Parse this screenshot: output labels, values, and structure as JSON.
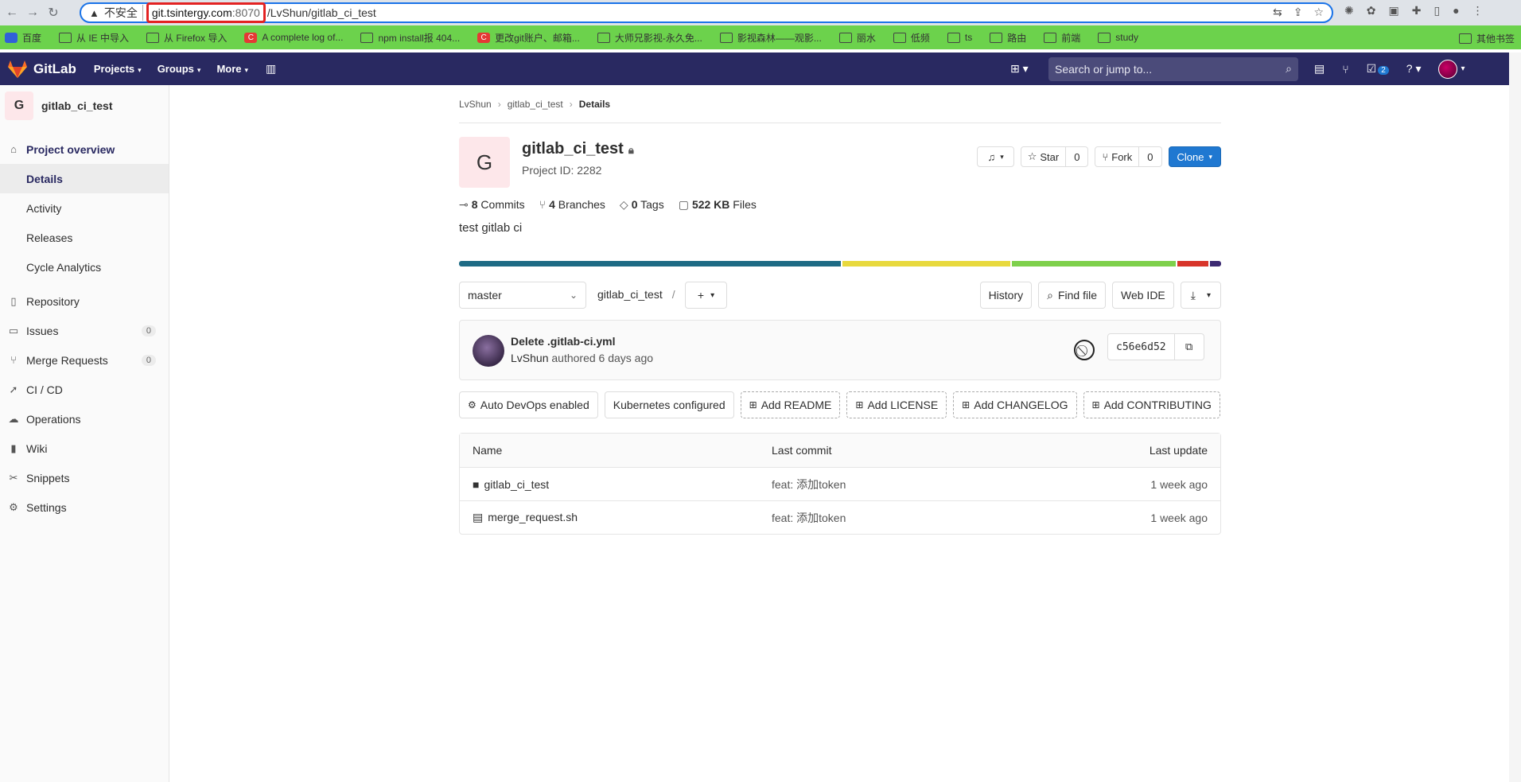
{
  "browser": {
    "insecure_label": "不安全",
    "url_host": "git.tsintergy.com",
    "url_port": ":8070",
    "url_path": "/LvShun/gitlab_ci_test",
    "bookmarks": [
      "百度",
      "从 IE 中导入",
      "从 Firefox 导入",
      "A complete log of...",
      "npm install报 404...",
      "更改git账户、邮箱...",
      "大师兄影视-永久免...",
      "影视森林——观影...",
      "丽水",
      "低频",
      "ts",
      "路由",
      "前端",
      "study"
    ],
    "bookmarks_other": "其他书签"
  },
  "header": {
    "brand": "GitLab",
    "nav": [
      "Projects",
      "Groups",
      "More"
    ],
    "search_placeholder": "Search or jump to...",
    "todo_count": "2"
  },
  "sidebar": {
    "project_initial": "G",
    "project_name": "gitlab_ci_test",
    "overview": "Project overview",
    "sub": [
      "Details",
      "Activity",
      "Releases",
      "Cycle Analytics"
    ],
    "items": [
      {
        "label": "Repository",
        "icon": "book-icon"
      },
      {
        "label": "Issues",
        "icon": "issues-icon",
        "count": "0"
      },
      {
        "label": "Merge Requests",
        "icon": "merge-icon",
        "count": "0"
      },
      {
        "label": "CI / CD",
        "icon": "rocket-icon"
      },
      {
        "label": "Operations",
        "icon": "cloud-icon"
      },
      {
        "label": "Wiki",
        "icon": "wiki-icon"
      },
      {
        "label": "Snippets",
        "icon": "scissors-icon"
      },
      {
        "label": "Settings",
        "icon": "gear-icon"
      }
    ]
  },
  "breadcrumb": [
    "LvShun",
    "gitlab_ci_test",
    "Details"
  ],
  "project": {
    "initial": "G",
    "title": "gitlab_ci_test",
    "id": "Project ID: 2282",
    "star_label": "Star",
    "star_count": "0",
    "fork_label": "Fork",
    "fork_count": "0",
    "clone_label": "Clone",
    "stats": {
      "commits_num": "8",
      "commits_label": "Commits",
      "branches_num": "4",
      "branches_label": "Branches",
      "tags_num": "0",
      "tags_label": "Tags",
      "files_num": "522 KB",
      "files_label": "Files"
    },
    "description": "test gitlab ci"
  },
  "lang_bar": [
    {
      "color": "#1e6b85",
      "share": 50
    },
    {
      "color": "#e8d93e",
      "share": 22
    },
    {
      "color": "#7ed04b",
      "share": 21.5
    },
    {
      "color": "#d8352a",
      "share": 4
    },
    {
      "color": "#3c2a72",
      "share": 1.5
    }
  ],
  "toolbar": {
    "branch": "master",
    "path": "gitlab_ci_test",
    "path_sep": "/",
    "history": "History",
    "find_file": "Find file",
    "web_ide": "Web IDE"
  },
  "commit": {
    "title": "Delete .gitlab-ci.yml",
    "author": "LvShun",
    "meta": "authored 6 days ago",
    "sha": "c56e6d52"
  },
  "chips": [
    {
      "label": "Auto DevOps enabled",
      "dashed": false,
      "icon": "gear"
    },
    {
      "label": "Kubernetes configured",
      "dashed": false,
      "icon": ""
    },
    {
      "label": "Add README",
      "dashed": true,
      "icon": "plus"
    },
    {
      "label": "Add LICENSE",
      "dashed": true,
      "icon": "plus"
    },
    {
      "label": "Add CHANGELOG",
      "dashed": true,
      "icon": "plus"
    },
    {
      "label": "Add CONTRIBUTING",
      "dashed": true,
      "icon": "plus"
    }
  ],
  "files": {
    "headers": [
      "Name",
      "Last commit",
      "Last update"
    ],
    "rows": [
      {
        "name": "gitlab_ci_test",
        "type": "folder",
        "commit": "feat: 添加token",
        "updated": "1 week ago"
      },
      {
        "name": "merge_request.sh",
        "type": "file",
        "commit": "feat: 添加token",
        "updated": "1 week ago"
      }
    ]
  }
}
